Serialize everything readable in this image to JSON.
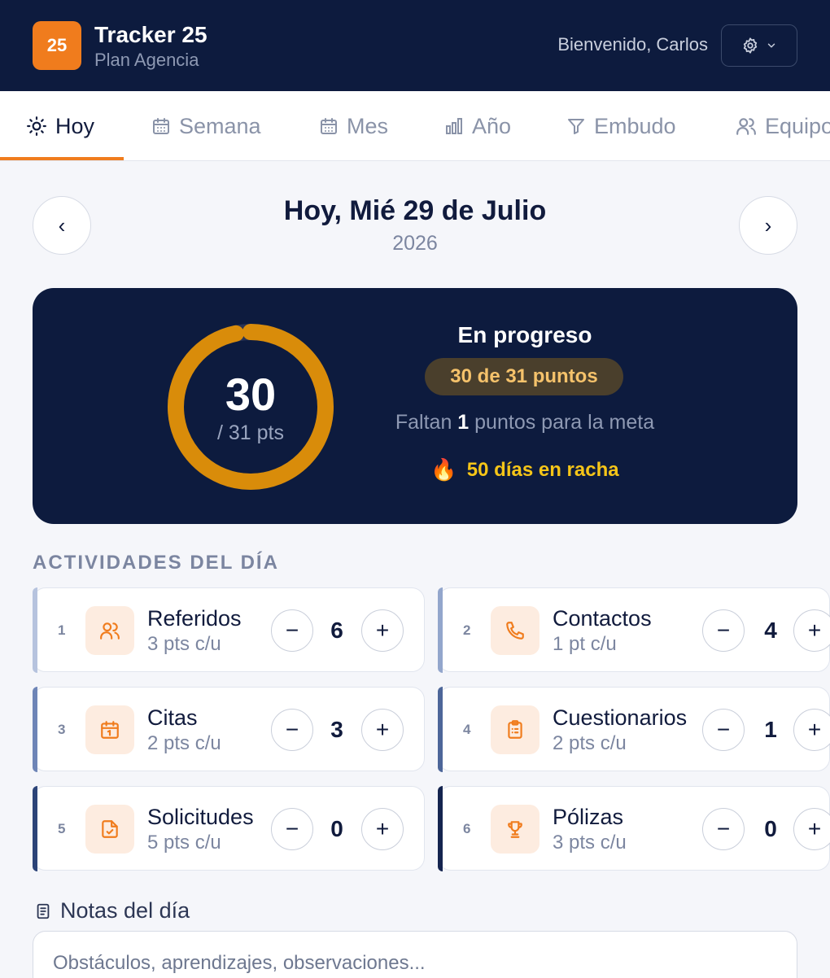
{
  "header": {
    "logo_text": "25",
    "title": "Tracker 25",
    "subtitle": "Plan Agencia",
    "welcome": "Bienvenido, Carlos",
    "settings_icon": "gear-icon"
  },
  "tabs": [
    {
      "label": "Hoy",
      "icon": "sun-icon",
      "active": true
    },
    {
      "label": "Semana",
      "icon": "calendar-icon"
    },
    {
      "label": "Mes",
      "icon": "calendar-icon"
    },
    {
      "label": "Año",
      "icon": "bar-chart-icon"
    },
    {
      "label": "Embudo",
      "icon": "funnel-icon"
    },
    {
      "label": "Equipo",
      "icon": "users-icon"
    }
  ],
  "date_nav": {
    "prev": "‹",
    "next": "›",
    "title": "Hoy, Mié 29 de Julio",
    "year": "2026"
  },
  "progress": {
    "value": "30",
    "target_label": "/ 31 pts",
    "fraction": 0.968,
    "status": "En progreso",
    "points_pill": "30 de 31 puntos",
    "remaining_prefix": "Faltan",
    "remaining_value": "1",
    "remaining_suffix": "puntos para la meta",
    "streak_emoji": "🔥",
    "streak": "50 días en racha",
    "ring_color": "#d98c0a"
  },
  "activities": {
    "section_title": "ACTIVIDADES DEL DÍA",
    "items": [
      {
        "num": "1",
        "name": "Referidos",
        "pts": "3 pts c/u",
        "count": "6",
        "icon": "users-icon",
        "accent": "#b6c3de"
      },
      {
        "num": "2",
        "name": "Contactos",
        "pts": "1 pt c/u",
        "count": "4",
        "icon": "phone-icon",
        "accent": "#93a6cc"
      },
      {
        "num": "3",
        "name": "Citas",
        "pts": "2 pts c/u",
        "count": "3",
        "icon": "calendar-icon",
        "accent": "#6e85b7"
      },
      {
        "num": "4",
        "name": "Cuestionarios",
        "pts": "2 pts c/u",
        "count": "1",
        "icon": "clipboard-icon",
        "accent": "#4d6699"
      },
      {
        "num": "5",
        "name": "Solicitudes",
        "pts": "5 pts c/u",
        "count": "0",
        "icon": "file-check-icon",
        "accent": "#2c4478"
      },
      {
        "num": "6",
        "name": "Pólizas",
        "pts": "3 pts c/u",
        "count": "0",
        "icon": "trophy-icon",
        "accent": "#14244f"
      }
    ],
    "minus": "−",
    "plus": "+"
  },
  "notes": {
    "label": "Notas del día",
    "placeholder": "Obstáculos, aprendizajes, observaciones..."
  },
  "colors": {
    "navy": "#0d1b3e",
    "orange": "#f07c1d",
    "gold": "#f5c518"
  }
}
